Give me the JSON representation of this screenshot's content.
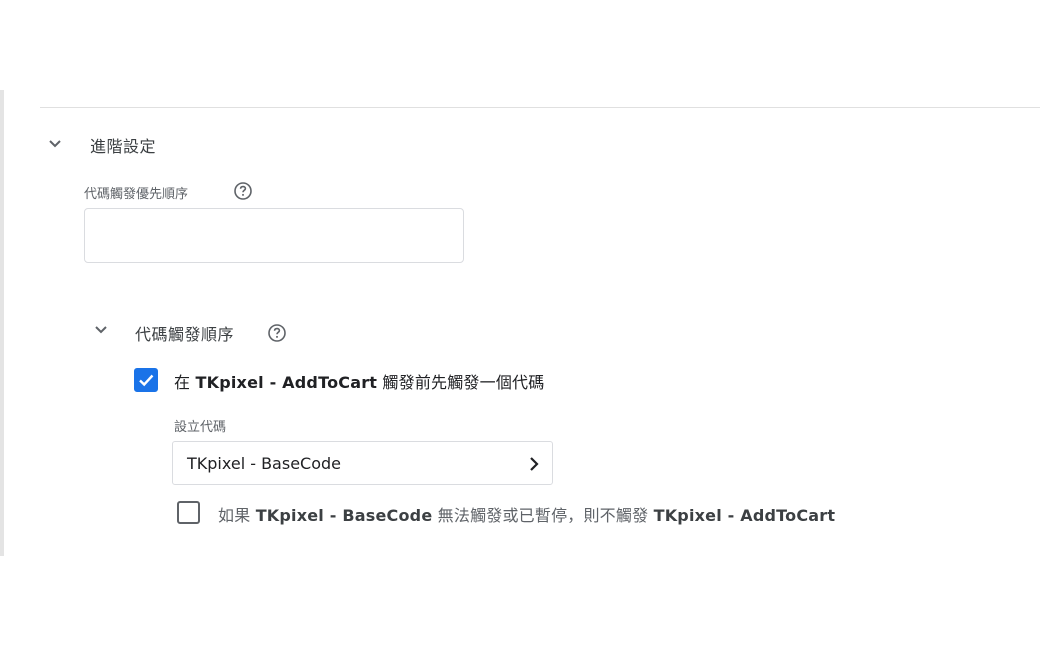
{
  "advanced": {
    "title": "進階設定",
    "priority_label": "代碼觸發優先順序",
    "priority_value": ""
  },
  "sequencing": {
    "title": "代碼觸發順序",
    "setup": {
      "checked": true,
      "prefix": "在 ",
      "tag_name": "TKpixel - AddToCart",
      "suffix": " 觸發前先觸發一個代碼"
    },
    "setup_tag_label": "設立代碼",
    "setup_tag_value": "TKpixel - BaseCode",
    "dont_fire": {
      "checked": false,
      "prefix": "如果 ",
      "setup_tag": "TKpixel - BaseCode",
      "middle": " 無法觸發或已暫停，則不觸發 ",
      "main_tag": "TKpixel - AddToCart"
    }
  },
  "icons": {
    "collapse": "chevron-down-icon",
    "help": "help-circle-icon",
    "select_arrow": "chevron-right-icon",
    "check": "check-icon"
  },
  "colors": {
    "accent": "#1a73e8",
    "text": "#202124",
    "secondary_text": "#5f6368",
    "border": "#dadce0"
  }
}
